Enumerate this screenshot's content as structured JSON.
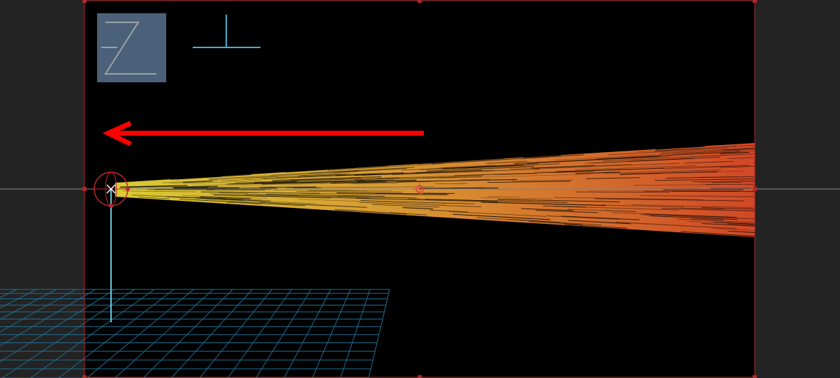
{
  "viewer": {
    "background": "#232323",
    "comp_background": "#000000",
    "comp_border_color": "#b0282a",
    "handle_color": "#b0282a",
    "horizon_color": "#8c8c8c"
  },
  "axis_gizmo": {
    "label": "Z",
    "box_color": "#4a6179",
    "stroke_color": "#9aa3a8",
    "icon": "z-axis-icon"
  },
  "ground_grid": {
    "color": "#1f6f92",
    "icon": "grid-floor"
  },
  "emitter": {
    "color": "#c0282c",
    "icon": "particle-emitter-icon",
    "stem_color": "#6ec6de"
  },
  "direction_arrow": {
    "color": "#ff0000",
    "icon": "arrow-left-icon"
  },
  "particle_stream": {
    "start_color": "#f3e23a",
    "mid_color": "#f0a838",
    "end_color": "#e8502a"
  },
  "anchor_point": {
    "icon": "anchor-crosshair-icon",
    "color": "#d8464a"
  },
  "camera_marker": {
    "icon": "camera-up-icon",
    "color": "#3fb2cf"
  }
}
